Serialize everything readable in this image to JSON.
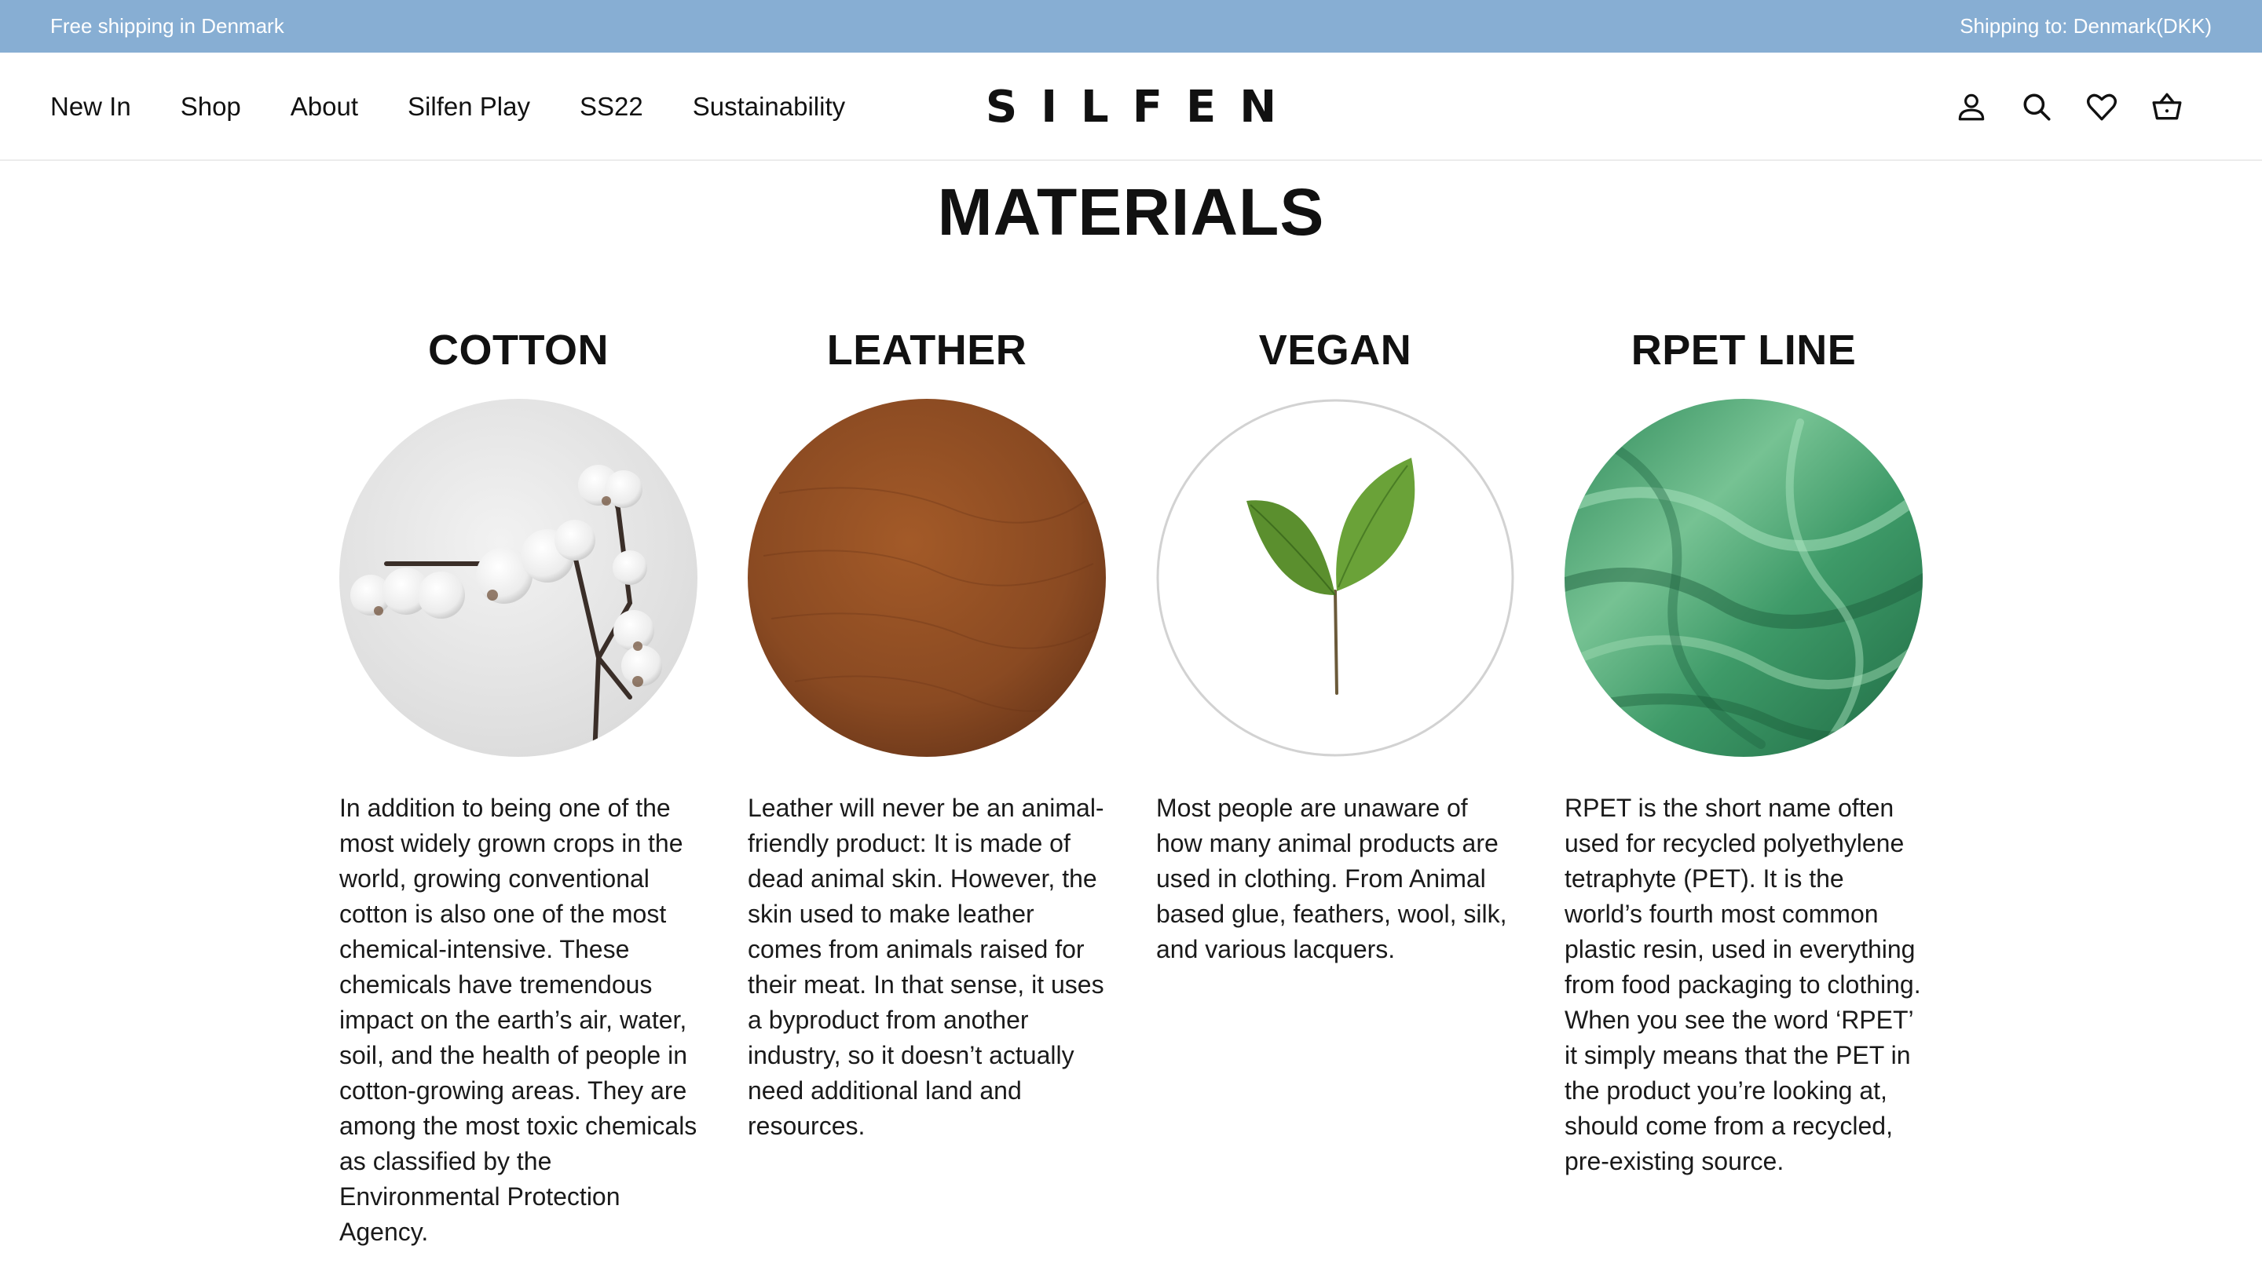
{
  "topbar": {
    "left_text": "Free shipping in Denmark",
    "right_text": "Shipping to: Denmark(DKK)"
  },
  "header": {
    "nav": [
      "New In",
      "Shop",
      "About",
      "Silfen Play",
      "SS22",
      "Sustainability"
    ],
    "logo": "SILFEN",
    "icons": [
      "account-icon",
      "search-icon",
      "heart-icon",
      "basket-icon"
    ]
  },
  "main": {
    "title": "MATERIALS",
    "materials": [
      {
        "name": "COTTON",
        "image": "cotton-branch-image",
        "description": "In addition to being one of the most widely grown crops in the world, growing conventional cotton is also one of the most chemical-intensive. These chemicals have tremendous impact on the earth’s air, water, soil, and the health of people in cotton-growing areas. They are among the most toxic chemicals as classified by the Environmental Protection Agency."
      },
      {
        "name": "LEATHER",
        "image": "leather-texture-image",
        "description": "Leather will never be an animal-friendly product: It is made of dead animal skin. However, the skin used to make leather comes from animals raised for their meat. In that sense, it uses a byproduct from another industry, so it doesn’t actually need additional land and resources."
      },
      {
        "name": "VEGAN",
        "image": "green-sprout-image",
        "description": "Most people are unaware of how many animal products are used in clothing. From Animal based glue, feathers, wool, silk, and various lacquers."
      },
      {
        "name": "RPET LINE",
        "image": "green-satin-fabric-image",
        "description": "RPET is the short name often used for recycled polyethylene tetraphyte (PET). It is the world’s fourth most common plastic resin, used in everything from food packaging to clothing. When you see the word ‘RPET’ it simply means that the PET in the product you’re looking at, should come from a recycled, pre-existing source."
      }
    ]
  },
  "colors": {
    "topbar_bg": "#87aed3",
    "text": "#111111",
    "leather": "#8a4a22",
    "rpet_green": "#5fae7e",
    "leaf_green": "#5b8f2e"
  }
}
